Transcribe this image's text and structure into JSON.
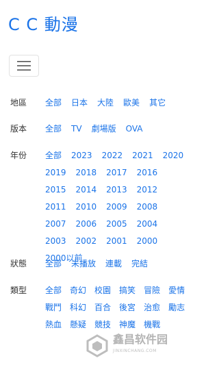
{
  "header": {
    "brand": "C C 動漫",
    "menu_icon": "hamburger-menu-icon"
  },
  "colors": {
    "accent": "#1a73e8",
    "label": "#333333"
  },
  "filters": {
    "region": {
      "label": "地區",
      "options": [
        "全部",
        "日本",
        "大陸",
        "歐美",
        "其它"
      ]
    },
    "version": {
      "label": "版本",
      "options": [
        "全部",
        "TV",
        "劇場版",
        "OVA"
      ]
    },
    "year": {
      "label": "年份",
      "options": [
        "全部",
        "2023",
        "2022",
        "2021",
        "2020",
        "2019",
        "2018",
        "2017",
        "2016",
        "2015",
        "2014",
        "2013",
        "2012",
        "2011",
        "2010",
        "2009",
        "2008",
        "2007",
        "2006",
        "2005",
        "2004",
        "2003",
        "2002",
        "2001",
        "2000",
        "2000以前"
      ]
    },
    "status": {
      "label": "狀態",
      "options": [
        "全部",
        "未播放",
        "連載",
        "完結"
      ]
    },
    "type": {
      "label": "類型",
      "options": [
        "全部",
        "奇幻",
        "校園",
        "搞笑",
        "冒險",
        "愛情",
        "戰鬥",
        "科幻",
        "百合",
        "後宮",
        "治愈",
        "勵志",
        "熱血",
        "懸疑",
        "競技",
        "神魔",
        "機戰"
      ]
    }
  },
  "watermark": {
    "title": "鑫昌软件园",
    "subtitle": "JINXINCHANG.COM",
    "logo_icon": "site-logo-icon"
  }
}
